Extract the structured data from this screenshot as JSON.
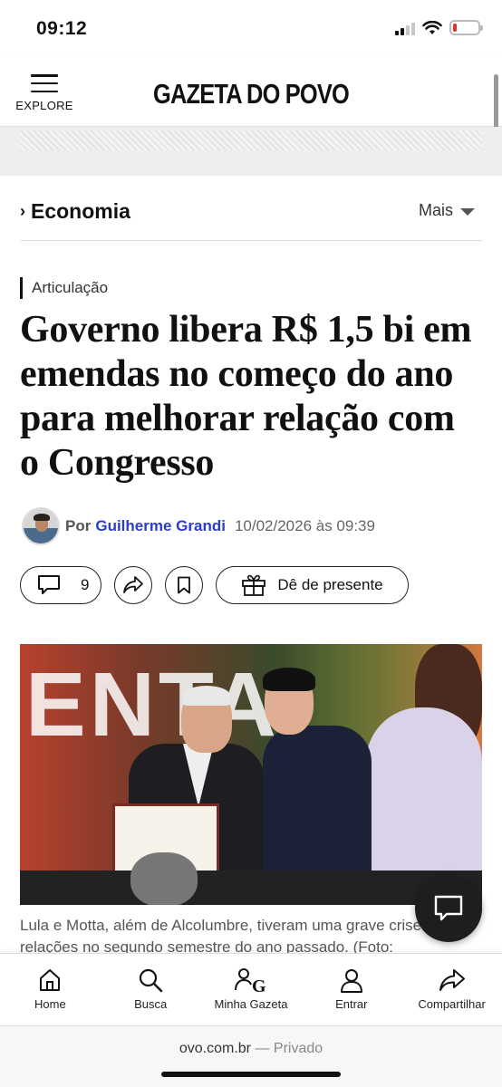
{
  "status_bar": {
    "time": "09:12",
    "battery_level": 0.12,
    "battery_color": "#e0312b",
    "icons": [
      "signal-icon",
      "wifi-icon",
      "battery-icon"
    ]
  },
  "header": {
    "menu_label": "EXPLORE",
    "logo": "GAZETA DO POVO"
  },
  "section": {
    "name": "Economia",
    "more_label": "Mais"
  },
  "article": {
    "kicker": "Articulação",
    "headline": "Governo libera R$ 1,5 bi em emendas no começo do ano para melhorar relação com o Congresso",
    "byline_prefix": "Por",
    "author": "Guilherme Grandi",
    "date": "10/02/2026 às 09:39",
    "author_color": "#2a3ec7",
    "photo_text": "ENTA",
    "caption": "Lula e Motta, além de Alcolumbre, tiveram uma grave crise nas relações no segundo semestre do ano passado. (Foto:"
  },
  "actions": {
    "comment_count": "9",
    "gift_label": "Dê de presente"
  },
  "bottom_nav": {
    "items": [
      {
        "label": "Home",
        "icon": "home-icon"
      },
      {
        "label": "Busca",
        "icon": "search-icon"
      },
      {
        "label": "Minha Gazeta",
        "icon": "minha-gazeta-icon"
      },
      {
        "label": "Entrar",
        "icon": "user-icon"
      },
      {
        "label": "Compartilhar",
        "icon": "share-icon"
      }
    ]
  },
  "browser": {
    "url": "ovo.com.br",
    "separator": "—",
    "mode": "Privado"
  }
}
